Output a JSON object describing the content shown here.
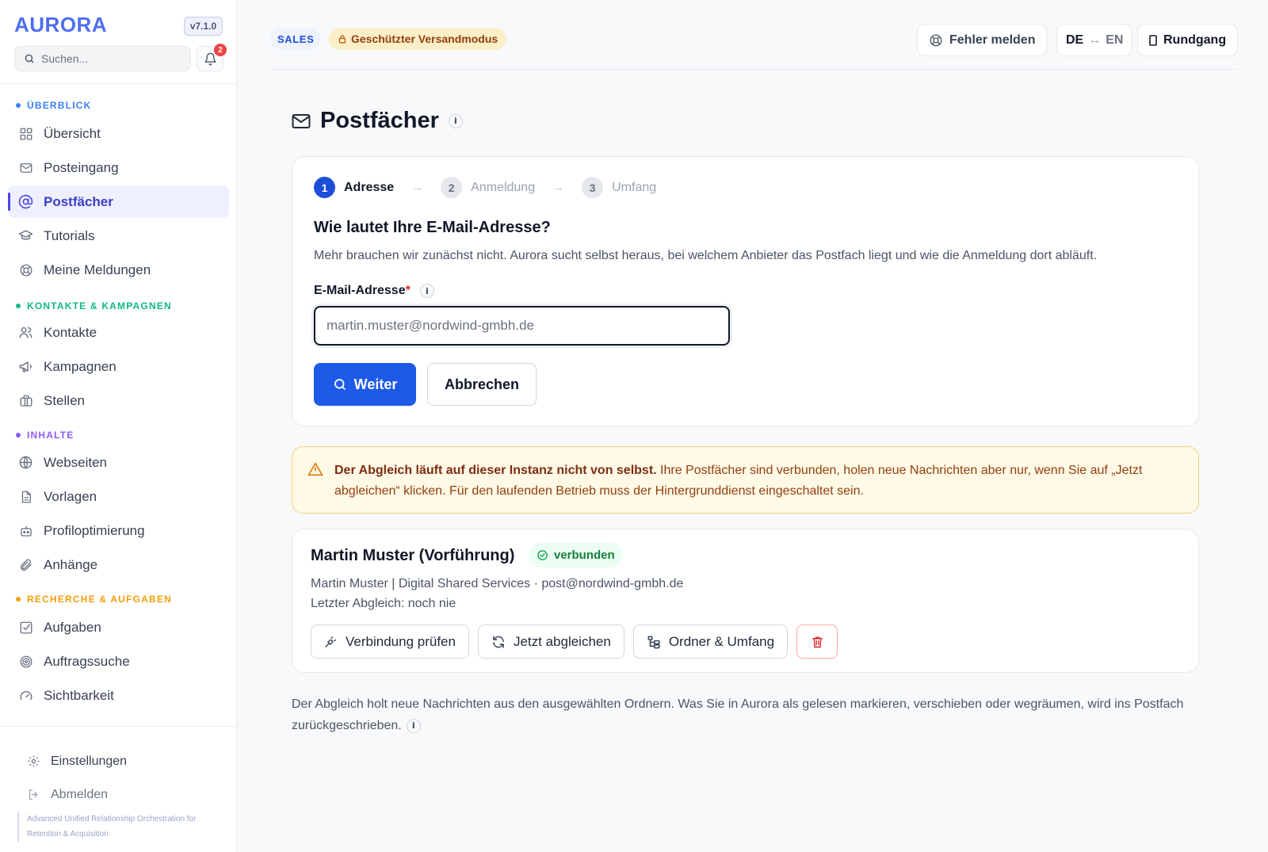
{
  "app": {
    "brand": "AURORA",
    "version": "v7.1.0",
    "notification_count": "2",
    "search_placeholder": "Suchen..."
  },
  "sidebar": {
    "sections": [
      {
        "label": "ÜBERBLICK",
        "color": "#3b82f6"
      },
      {
        "label": "KONTAKTE & KAMPAGNEN",
        "color": "#10b981"
      },
      {
        "label": "INHALTE",
        "color": "#8b5cf6"
      },
      {
        "label": "RECHERCHE & AUFGABEN",
        "color": "#f59e0b"
      }
    ],
    "items": [
      {
        "label": "Übersicht",
        "icon": "dashboard-icon"
      },
      {
        "label": "Posteingang",
        "icon": "inbox-icon"
      },
      {
        "label": "Postfächer",
        "icon": "at-icon",
        "active": true
      },
      {
        "label": "Tutorials",
        "icon": "graduation-cap-icon"
      },
      {
        "label": "Meine Meldungen",
        "icon": "lifebuoy-icon"
      },
      {
        "label": "Kontakte",
        "icon": "users-icon"
      },
      {
        "label": "Kampagnen",
        "icon": "megaphone-icon"
      },
      {
        "label": "Stellen",
        "icon": "briefcase-icon"
      },
      {
        "label": "Webseiten",
        "icon": "globe-icon"
      },
      {
        "label": "Vorlagen",
        "icon": "document-icon"
      },
      {
        "label": "Profiloptimierung",
        "icon": "robot-icon"
      },
      {
        "label": "Anhänge",
        "icon": "paperclip-icon"
      },
      {
        "label": "Aufgaben",
        "icon": "checkbox-icon"
      },
      {
        "label": "Auftragssuche",
        "icon": "target-icon"
      },
      {
        "label": "Sichtbarkeit",
        "icon": "gauge-icon"
      }
    ],
    "bottom": {
      "settings_label": "Einstellungen",
      "logout_label": "Abmelden"
    },
    "acronym_lines": [
      "Advanced Unified Relationship Orchestration for",
      "Retention & Acquisition"
    ]
  },
  "topbar": {
    "workspace_badge": "SALES",
    "mode_badge": "Geschützter Versandmodus",
    "report_button": "Fehler melden",
    "lang_from": "DE",
    "lang_switch": "↔",
    "lang_to": "EN",
    "tour_button": "Rundgang"
  },
  "page": {
    "title": "Postfächer",
    "info": "i"
  },
  "wizard": {
    "steps": [
      {
        "number": "1",
        "label": "Adresse",
        "state": "active"
      },
      {
        "number": "2",
        "label": "Anmeldung",
        "state": "pending"
      },
      {
        "number": "3",
        "label": "Umfang",
        "state": "pending"
      }
    ],
    "heading": "Wie lautet Ihre E-Mail-Adresse?",
    "lead": "Mehr brauchen wir zunächst nicht. Aurora sucht selbst heraus, bei welchem Anbieter das Postfach liegt und wie die Anmeldung dort abläuft.",
    "email_label": "E-Mail-Adresse",
    "required_mark": "*",
    "email_value": "",
    "email_placeholder": "martin.muster@nordwind-gmbh.de",
    "submit_label": "Weiter",
    "cancel_label": "Abbrechen"
  },
  "alert": {
    "strong": "Der Abgleich läuft auf dieser Instanz nicht von selbst.",
    "text": " Ihre Postfächer sind verbunden, holen neue Nachrichten aber nur, wenn Sie auf „Jetzt abgleichen“ klicken. Für den laufenden Betrieb muss der Hintergrunddienst eingeschaltet sein."
  },
  "mailbox": {
    "name": "Martin Muster (Vorführung)",
    "status": "verbunden",
    "status_color": "#15803d",
    "meta": "Martin Muster | Digital Shared Services · post@nordwind-gmbh.de",
    "last_sync": "Letzter Abgleich: noch nie",
    "actions": {
      "check": "Verbindung prüfen",
      "sync": "Jetzt abgleichen",
      "folders": "Ordner & Umfang"
    }
  },
  "footnote": "Der Abgleich holt neue Nachrichten aus den ausgewählten Ordnern. Was Sie in Aurora als gelesen markieren, verschieben oder wegräumen, wird ins Postfach zurückgeschrieben.",
  "colors": {
    "primary": "#1d5ae8",
    "brand": "#4f6ef2",
    "active_nav": "#eef0fd",
    "warning_bg": "#fff9e6",
    "danger": "#dc2626"
  }
}
